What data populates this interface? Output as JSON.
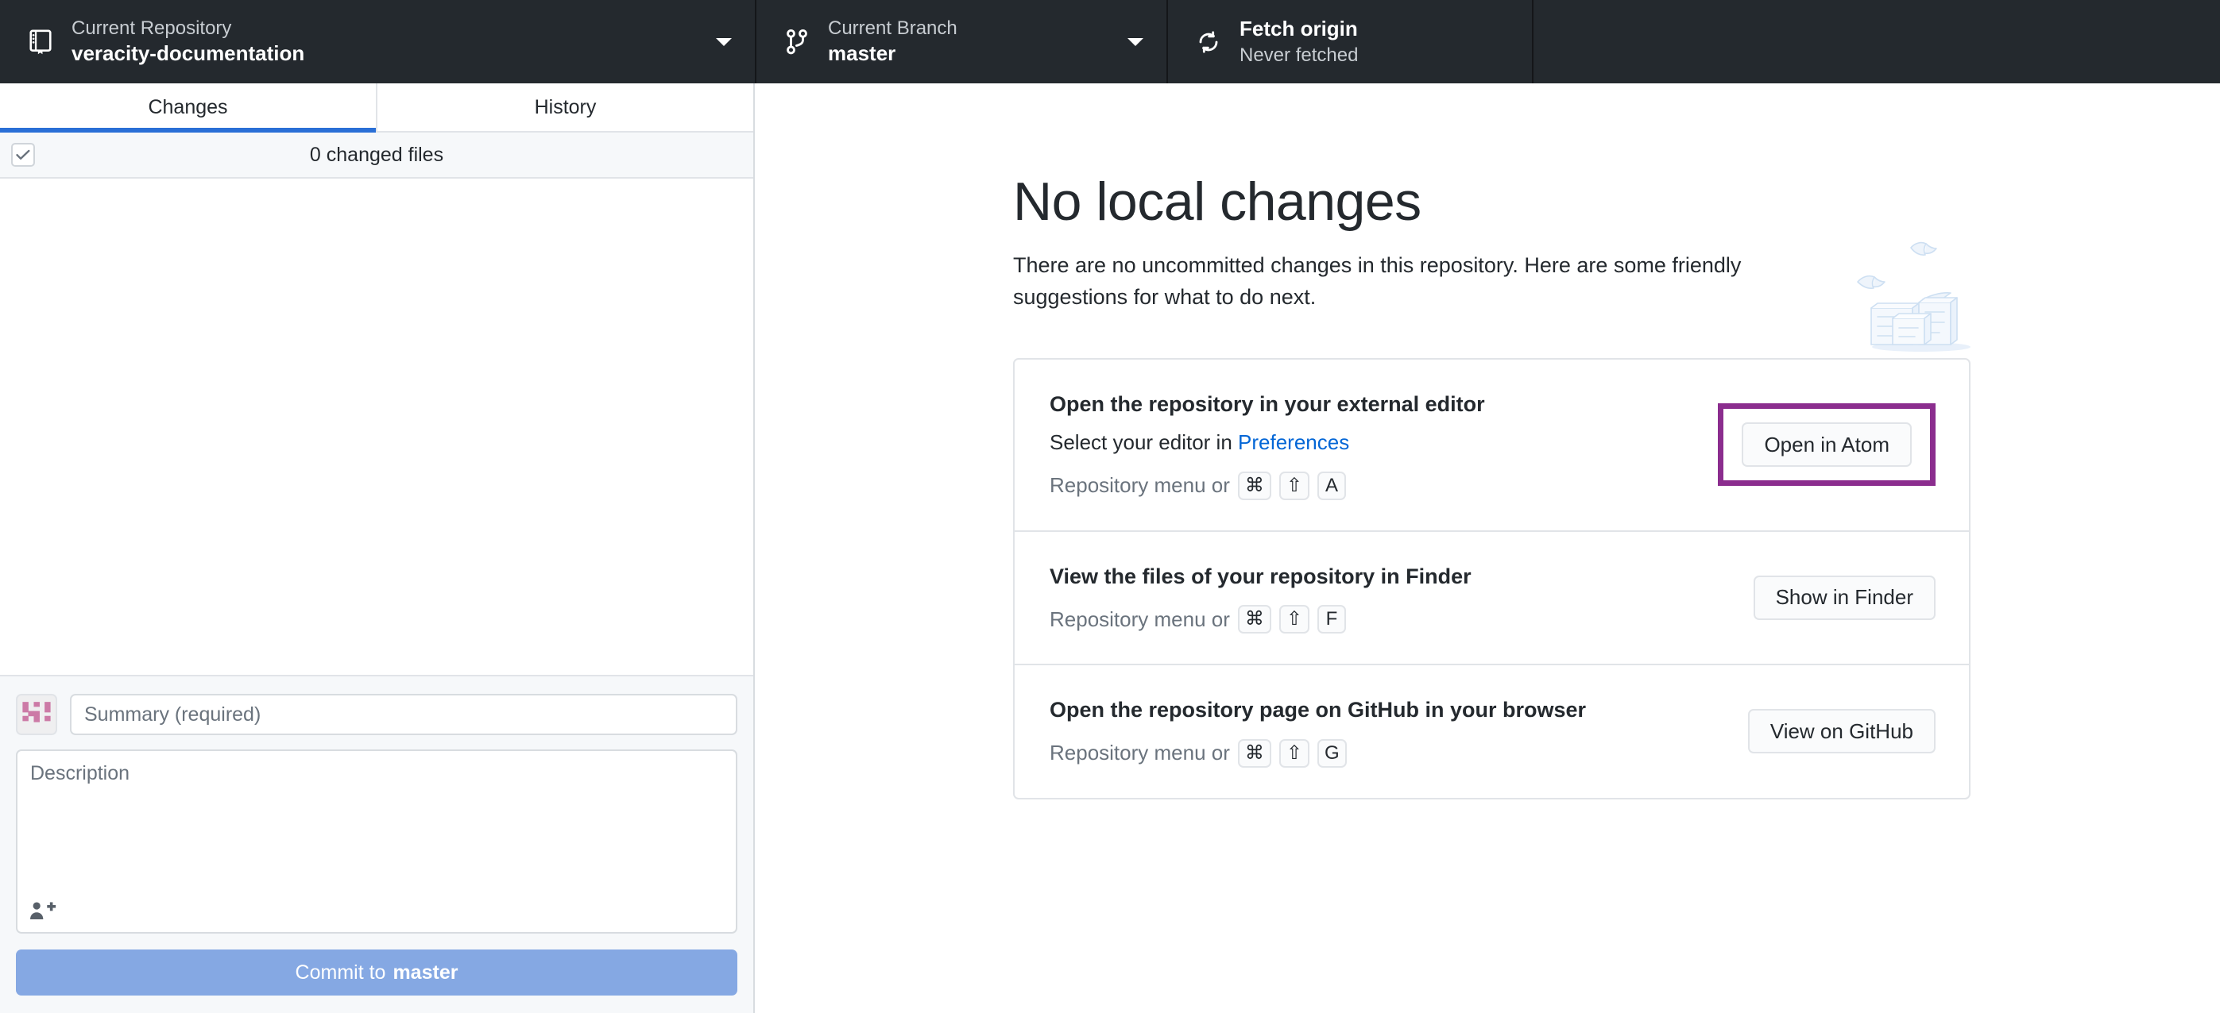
{
  "toolbar": {
    "repository": {
      "label": "Current Repository",
      "value": "veracity-documentation",
      "icon": "repo-book-icon"
    },
    "branch": {
      "label": "Current Branch",
      "value": "master",
      "icon": "git-branch-icon"
    },
    "fetch": {
      "title": "Fetch origin",
      "subtitle": "Never fetched",
      "icon": "sync-icon"
    }
  },
  "sidebar": {
    "tabs": [
      {
        "label": "Changes",
        "active": true
      },
      {
        "label": "History",
        "active": false
      }
    ],
    "changed_files_text": "0 changed files",
    "select_all_checked": true,
    "commit": {
      "summary_placeholder": "Summary (required)",
      "summary_value": "",
      "description_placeholder": "Description",
      "description_value": "",
      "coauthor_icon": "add-person-icon",
      "button_prefix": "Commit to",
      "button_branch": "master"
    }
  },
  "main": {
    "title": "No local changes",
    "subtitle": "There are no uncommitted changes in this repository. Here are some friendly suggestions for what to do next.",
    "illustration": "paper-stack-illustration",
    "suggestions": [
      {
        "title": "Open the repository in your external editor",
        "description_prefix": "Select your editor in ",
        "description_link": "Preferences",
        "shortcut_prefix": "Repository menu or",
        "keys": [
          "⌘",
          "⇧",
          "A"
        ],
        "button_label": "Open in Atom",
        "highlighted": true,
        "highlight_color": "#8b2d8e"
      },
      {
        "title": "View the files of your repository in Finder",
        "description_prefix": "",
        "description_link": "",
        "shortcut_prefix": "Repository menu or",
        "keys": [
          "⌘",
          "⇧",
          "F"
        ],
        "button_label": "Show in Finder",
        "highlighted": false,
        "highlight_color": ""
      },
      {
        "title": "Open the repository page on GitHub in your browser",
        "description_prefix": "",
        "description_link": "",
        "shortcut_prefix": "Repository menu or",
        "keys": [
          "⌘",
          "⇧",
          "G"
        ],
        "button_label": "View on GitHub",
        "highlighted": false,
        "highlight_color": ""
      }
    ]
  },
  "colors": {
    "toolbar_bg": "#24292e",
    "accent_blue": "#2a6fd6",
    "link_blue": "#0366d6",
    "commit_button": "#85a8e3",
    "highlight_purple": "#8b2d8e",
    "illustration_blue": "#cddff2"
  }
}
